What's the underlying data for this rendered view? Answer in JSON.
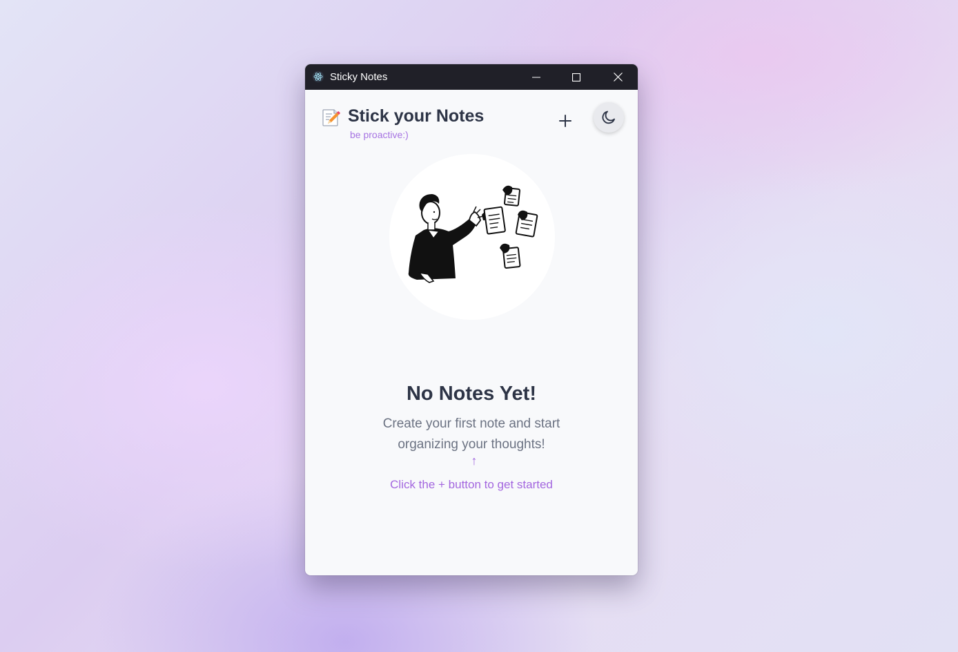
{
  "window": {
    "title": "Sticky Notes",
    "app_icon": "electron-atom-icon",
    "controls": {
      "minimize_icon": "minimize-icon",
      "maximize_icon": "maximize-icon",
      "close_icon": "close-icon"
    }
  },
  "header": {
    "icon": "memo-pencil-icon",
    "title": "Stick your Notes",
    "tagline": "be proactive:)",
    "add_button_icon": "plus-icon",
    "theme_toggle_icon": "moon-icon"
  },
  "empty_state": {
    "illustration": "person-pinning-notes-illustration",
    "title": "No Notes Yet!",
    "description": "Create your first note and start organizing your thoughts!",
    "arrow": "↑",
    "hint": "Click the + button to get started"
  },
  "colors": {
    "titlebar": "#202028",
    "heading": "#2d3446",
    "accent": "#a366df",
    "muted_text": "#6b7282",
    "surface": "#f8f9fb"
  }
}
